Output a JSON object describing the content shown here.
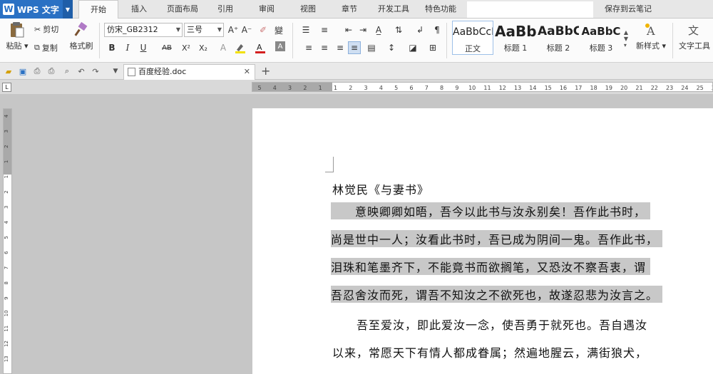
{
  "app": {
    "name": "WPS 文字",
    "title_logo": "W"
  },
  "tabs": [
    {
      "label": "开始",
      "active": true
    },
    {
      "label": "插入"
    },
    {
      "label": "页面布局"
    },
    {
      "label": "引用"
    },
    {
      "label": "审阅"
    },
    {
      "label": "视图"
    },
    {
      "label": "章节"
    },
    {
      "label": "开发工具"
    },
    {
      "label": "特色功能"
    }
  ],
  "save_cloud": "保存到云笔记",
  "ribbon": {
    "paste": "粘贴",
    "cut": "剪切",
    "copy": "复制",
    "format_painter": "格式刷",
    "font_name": "仿宋_GB2312",
    "font_size": "三号",
    "styles": [
      {
        "sample": "AaBbCcDd",
        "label": "正文"
      },
      {
        "sample": "AaBb",
        "label": "标题 1"
      },
      {
        "sample": "AaBbC",
        "label": "标题 2"
      },
      {
        "sample": "AaBbC",
        "label": "标题 3"
      }
    ],
    "new_style": "新样式",
    "text_tools": "文字工具",
    "bold": "B",
    "italic": "I",
    "underline": "U",
    "strikethrough": "AB",
    "superscript": "X²",
    "subscript": "X₂",
    "grow_font": "A⁺",
    "shrink_font": "A⁻"
  },
  "document_tab": {
    "filename": "百度经验.doc"
  },
  "ruler": {
    "h_ticks": [
      "5",
      "4",
      "3",
      "2",
      "1",
      "1",
      "2",
      "3",
      "4",
      "5",
      "6",
      "7",
      "8",
      "9",
      "10",
      "11",
      "12",
      "13",
      "14",
      "15",
      "16",
      "17",
      "18",
      "19",
      "20",
      "21",
      "22",
      "23",
      "24",
      "25",
      "26"
    ],
    "v_ticks": [
      "4",
      "3",
      "2",
      "1",
      "1",
      "2",
      "3",
      "4",
      "5",
      "6",
      "7",
      "8",
      "9",
      "10",
      "11",
      "12",
      "13"
    ]
  },
  "document": {
    "lines": [
      {
        "text": "林觉民《与妻书》",
        "highlight": false
      },
      {
        "text": "　　意映卿卿如晤，吾今以此书与汝永别矣！吾作此书时，",
        "highlight": true
      },
      {
        "text": "尚是世中一人；汝看此书时，吾已成为阴间一鬼。吾作此书，",
        "highlight": true
      },
      {
        "text": "泪珠和笔墨齐下，不能竟书而欲搁笔，又恐汝不察吾衷，谓",
        "highlight": true
      },
      {
        "text": "吾忍舍汝而死，谓吾不知汝之不欲死也，故遂忍悲为汝言之。",
        "highlight": true
      },
      {
        "text": "　　吾至爱汝，即此爱汝一念，使吾勇于就死也。吾自遇汝",
        "highlight": false
      },
      {
        "text": "以来，常愿天下有情人都成眷属；然遍地腥云，满街狼犬，",
        "highlight": false
      }
    ]
  }
}
